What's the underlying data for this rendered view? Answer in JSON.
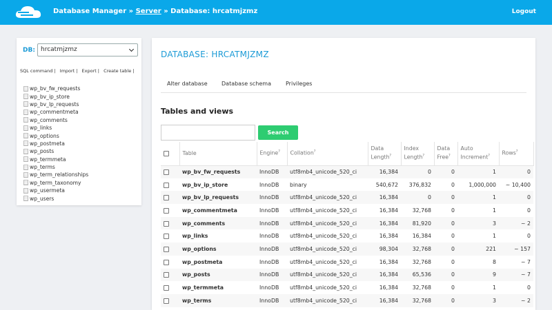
{
  "header": {
    "breadcrumb_app": "Database Manager",
    "breadcrumb_sep1": " » ",
    "breadcrumb_server": "Server",
    "breadcrumb_sep2": " » ",
    "breadcrumb_db": "Database: hrcatmjzmz",
    "logout": "Logout",
    "logo_icon": "cloud-icon",
    "bg_color": "#0aa8e9"
  },
  "sidebar": {
    "db_label": "DB:",
    "db_selected": "hrcatmjzmz",
    "links": [
      "SQL command",
      "Import",
      "Export",
      "Create table"
    ],
    "link_sep": "|",
    "tables": [
      "wp_bv_fw_requests",
      "wp_bv_ip_store",
      "wp_bv_lp_requests",
      "wp_commentmeta",
      "wp_comments",
      "wp_links",
      "wp_options",
      "wp_postmeta",
      "wp_posts",
      "wp_termmeta",
      "wp_terms",
      "wp_term_relationships",
      "wp_term_taxonomy",
      "wp_usermeta",
      "wp_users"
    ]
  },
  "main": {
    "title": "DATABASE: HRCATMJZMZ",
    "tabs": [
      "Alter database",
      "Database schema",
      "Privileges"
    ],
    "section_title": "Tables and views",
    "search_value": "",
    "search_button": "Search",
    "accent_color": "#1a9ad6",
    "button_color": "#2ecc71"
  },
  "table": {
    "headers": {
      "table": "Table",
      "engine": "Engine",
      "collation": "Collation",
      "data_length_1": "Data",
      "data_length_2": "Length",
      "index_length_1": "Index",
      "index_length_2": "Length",
      "data_free_1": "Data",
      "data_free_2": "Free",
      "auto_inc_1": "Auto",
      "auto_inc_2": "Increment",
      "rows": "Rows",
      "help_mark": "?"
    },
    "rows": [
      {
        "name": "wp_bv_fw_requests",
        "engine": "InnoDB",
        "collation": "utf8mb4_unicode_520_ci",
        "data_length": "16,384",
        "index_length": "0",
        "data_free": "0",
        "auto_increment": "1",
        "rows": "0"
      },
      {
        "name": "wp_bv_ip_store",
        "engine": "InnoDB",
        "collation": "binary",
        "data_length": "540,672",
        "index_length": "376,832",
        "data_free": "0",
        "auto_increment": "1,000,000",
        "rows": "~ 10,400"
      },
      {
        "name": "wp_bv_lp_requests",
        "engine": "InnoDB",
        "collation": "utf8mb4_unicode_520_ci",
        "data_length": "16,384",
        "index_length": "0",
        "data_free": "0",
        "auto_increment": "1",
        "rows": "0"
      },
      {
        "name": "wp_commentmeta",
        "engine": "InnoDB",
        "collation": "utf8mb4_unicode_520_ci",
        "data_length": "16,384",
        "index_length": "32,768",
        "data_free": "0",
        "auto_increment": "1",
        "rows": "0"
      },
      {
        "name": "wp_comments",
        "engine": "InnoDB",
        "collation": "utf8mb4_unicode_520_ci",
        "data_length": "16,384",
        "index_length": "81,920",
        "data_free": "0",
        "auto_increment": "3",
        "rows": "~ 2"
      },
      {
        "name": "wp_links",
        "engine": "InnoDB",
        "collation": "utf8mb4_unicode_520_ci",
        "data_length": "16,384",
        "index_length": "16,384",
        "data_free": "0",
        "auto_increment": "1",
        "rows": "0"
      },
      {
        "name": "wp_options",
        "engine": "InnoDB",
        "collation": "utf8mb4_unicode_520_ci",
        "data_length": "98,304",
        "index_length": "32,768",
        "data_free": "0",
        "auto_increment": "221",
        "rows": "~ 157"
      },
      {
        "name": "wp_postmeta",
        "engine": "InnoDB",
        "collation": "utf8mb4_unicode_520_ci",
        "data_length": "16,384",
        "index_length": "32,768",
        "data_free": "0",
        "auto_increment": "8",
        "rows": "~ 7"
      },
      {
        "name": "wp_posts",
        "engine": "InnoDB",
        "collation": "utf8mb4_unicode_520_ci",
        "data_length": "16,384",
        "index_length": "65,536",
        "data_free": "0",
        "auto_increment": "9",
        "rows": "~ 7"
      },
      {
        "name": "wp_termmeta",
        "engine": "InnoDB",
        "collation": "utf8mb4_unicode_520_ci",
        "data_length": "16,384",
        "index_length": "32,768",
        "data_free": "0",
        "auto_increment": "1",
        "rows": "0"
      },
      {
        "name": "wp_terms",
        "engine": "InnoDB",
        "collation": "utf8mb4_unicode_520_ci",
        "data_length": "16,384",
        "index_length": "32,768",
        "data_free": "0",
        "auto_increment": "3",
        "rows": "~ 2"
      }
    ]
  }
}
